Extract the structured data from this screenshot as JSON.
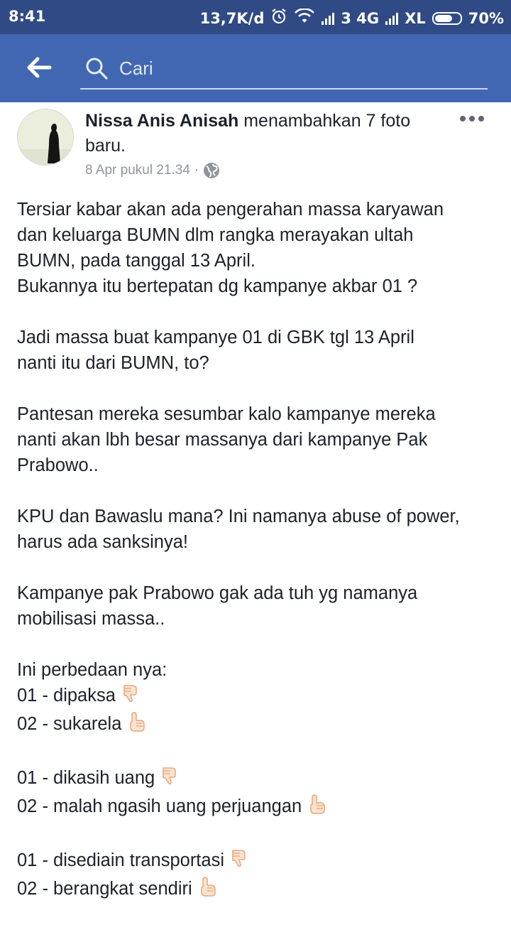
{
  "status_bar": {
    "time": "8:41",
    "speed": "13,7K/d",
    "network_1": "3 4G",
    "network_2": "XL",
    "battery": "70%",
    "battery_level": 0.7
  },
  "app_bar": {
    "search_placeholder": "Cari",
    "icons": {
      "back": "arrow-left-icon",
      "search": "search-icon"
    }
  },
  "post": {
    "author": "Nissa Anis Anisah",
    "action": "menambahkan 7 foto baru.",
    "timestamp": "8 Apr pukul 21.34",
    "separator": "·",
    "privacy_icon": "globe-icon",
    "paragraphs": [
      [
        "Tersiar kabar akan ada pengerahan massa karyawan",
        "dan keluarga  BUMN dlm rangka merayakan ultah",
        "BUMN, pada tanggal 13 April.",
        "Bukannya itu bertepatan dg kampanye akbar 01 ?"
      ],
      [
        "Jadi massa buat kampanye 01 di GBK tgl 13 April",
        "nanti itu dari BUMN, to?"
      ],
      [
        "Pantesan mereka sesumbar kalo kampanye mereka",
        "nanti akan lbh besar massanya dari kampanye Pak",
        "Prabowo.."
      ],
      [
        "KPU dan Bawaslu mana? Ini namanya abuse of power,",
        "harus ada sanksinya!"
      ],
      [
        "Kampanye pak Prabowo gak ada tuh yg namanya",
        "mobilisasi massa.."
      ]
    ],
    "comparison_title": "Ini perbedaan nya:",
    "comparisons": [
      [
        "01 - dipaksa",
        "02 - sukarela"
      ],
      [
        "01 - dikasih uang",
        "02 - malah ngasih uang perjuangan"
      ],
      [
        "01 - disediain transportasi",
        "02 - berangkat sendiri"
      ]
    ],
    "emoji": {
      "01": "thumbs-down-hand-icon",
      "02": "pointing-up-hand-icon"
    }
  }
}
